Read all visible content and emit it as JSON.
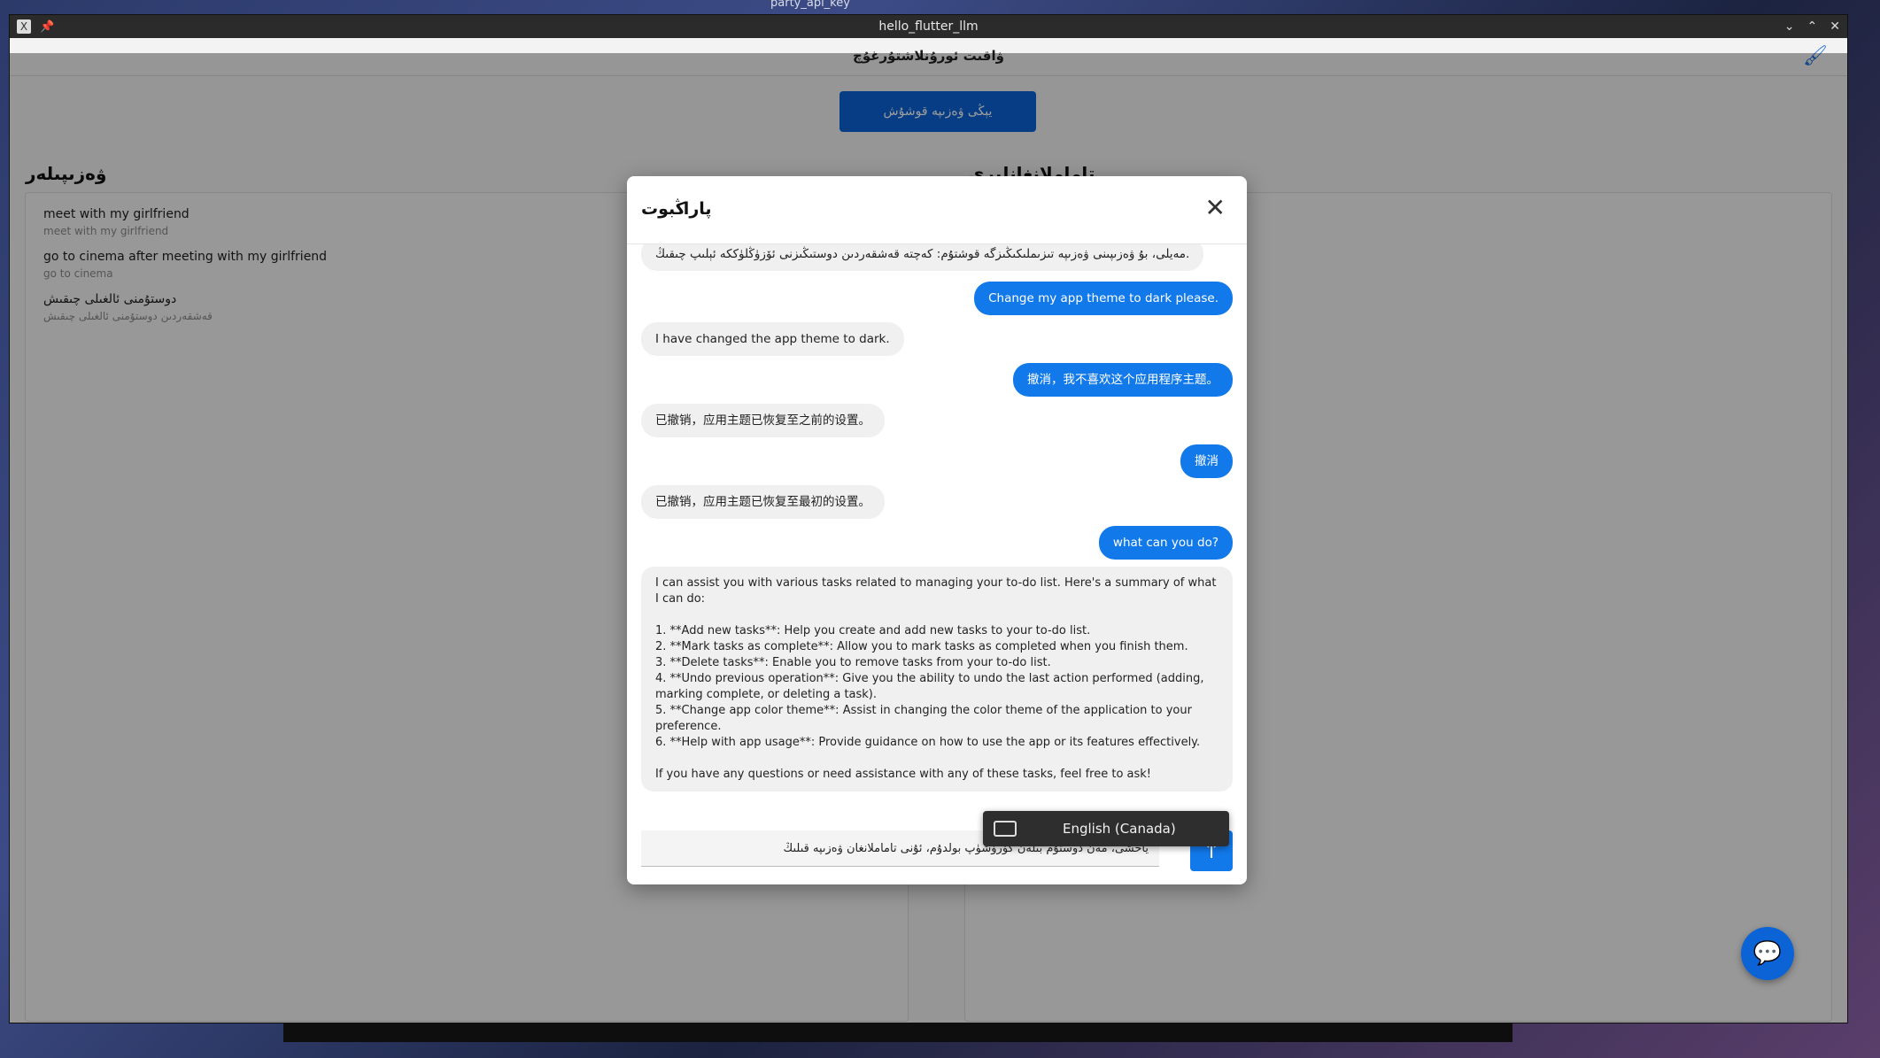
{
  "desktop": {
    "top_label": "party_api_key"
  },
  "window": {
    "title": "hello_flutter_llm",
    "app_icon": "x-icon",
    "controls": [
      "chevron-down-icon",
      "chevron-up-icon",
      "close-icon"
    ]
  },
  "appbar": {
    "title": "ۋاقىت ئورۇنلاشتۇرغۇچ",
    "theme_icon": "brush-icon"
  },
  "add_task_label": "يېڭى ۋەزىپە قوشۇش",
  "left_panel": {
    "title": "ۋەزىپىلەر",
    "tasks": [
      {
        "title": "meet with my girlfriend",
        "subtitle": "meet with my girlfriend"
      },
      {
        "title": "go to cinema after meeting with my girlfriend",
        "subtitle": "go to cinema"
      },
      {
        "title": "دوستۇمنى ئالغىلى چىقىش",
        "subtitle": "قەشقەردىن دوستۇمنى ئالغىلى چىقىش"
      }
    ]
  },
  "right_panel": {
    "title": "تاماملانغانلىرى"
  },
  "dialog": {
    "title": "پاراڭبوت",
    "messages": [
      {
        "role": "bot",
        "text": "مەيلى، بۇ ۋەزىپىنى ۋەزىپە تىزىملىكىڭىزگە قوشتۇم: كەچتە قەشقەردىن دوستىڭىزنى ئۆزۈڭلۈككە ئېلىپ چىقىڭ."
      },
      {
        "role": "user",
        "text": "Change my app theme to dark please."
      },
      {
        "role": "bot",
        "text": "I have changed the app theme to dark."
      },
      {
        "role": "user",
        "text": "撤消，我不喜欢这个应用程序主题。"
      },
      {
        "role": "bot",
        "text": "已撤销，应用主题已恢复至之前的设置。"
      },
      {
        "role": "user",
        "text": "撤消"
      },
      {
        "role": "bot",
        "text": "已撤销，应用主题已恢复至最初的设置。"
      },
      {
        "role": "user",
        "text": "what can you do?"
      },
      {
        "role": "bot",
        "text": "I can assist you with various tasks related to managing your to-do list. Here's a summary of what I can do:\n\n1. **Add new tasks**: Help you create and add new tasks to your to-do list.\n2. **Mark tasks as complete**: Allow you to mark tasks as completed when you finish them.\n3. **Delete tasks**: Enable you to remove tasks from your to-do list.\n4. **Undo previous operation**: Give you the ability to undo the last action performed (adding, marking complete, or deleting a task).\n5. **Change app color theme**: Assist in changing the color theme of the application to your preference.\n6. **Help with app usage**: Provide guidance on how to use the app or its features effectively.\n\nIf you have any questions or need assistance with any of these tasks, feel free to ask!"
      }
    ],
    "input_value": "ياخشى، مەن دوستۇم بىلەن كۆرۈشۈپ بولدۇم، ئۇنى تاماملانغان ۋەزىپە قىلىڭ",
    "send_icon": "arrow-up-icon",
    "close_icon": "close-icon"
  },
  "ime_popup": {
    "label": "English (Canada)",
    "icon": "keyboard-icon"
  },
  "fab_icon": "chat-bubble-icon"
}
